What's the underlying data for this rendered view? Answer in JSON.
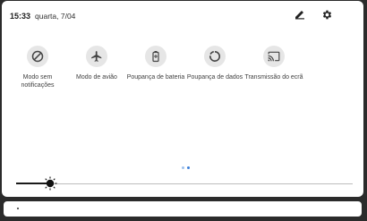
{
  "status": {
    "time": "15:33",
    "date": "quarta, 7/04"
  },
  "header_icons": [
    {
      "name": "edit-icon"
    },
    {
      "name": "settings-icon"
    }
  ],
  "tiles": [
    {
      "icon": "do-not-disturb-icon",
      "label_line1": "Modo sem",
      "label_line2": "notificações"
    },
    {
      "icon": "airplane-icon",
      "label_line1": "Modo de avião",
      "label_line2": ""
    },
    {
      "icon": "battery-saver-icon",
      "label_line1": "Poupança de bateria",
      "label_line2": ""
    },
    {
      "icon": "data-saver-icon",
      "label_line1": "Poupança de dados",
      "label_line2": ""
    },
    {
      "icon": "cast-icon",
      "label_line1": "Transmissão do ecrã",
      "label_line2": ""
    }
  ],
  "pager": {
    "pages": 2,
    "current": 2
  },
  "brightness": {
    "level": 0.1
  },
  "colors": {
    "accent": "#3b7fd9",
    "inactive_dot": "#9ec0ec",
    "tile_bg": "#e6e6e6"
  }
}
